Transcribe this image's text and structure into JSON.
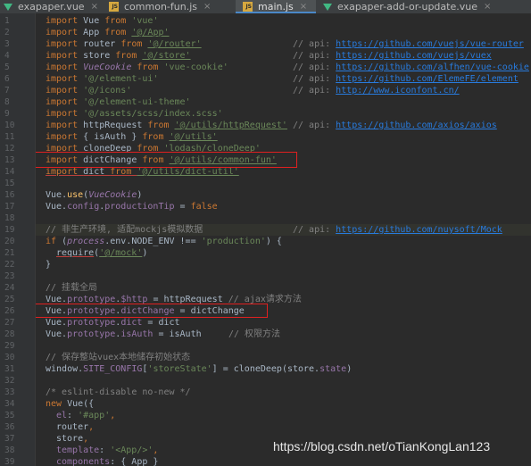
{
  "tabs": [
    {
      "label": "exapaper.vue",
      "type": "vue",
      "active": false
    },
    {
      "label": "common-fun.js",
      "type": "js",
      "active": false
    },
    {
      "label": "main.js",
      "type": "js",
      "active": true
    },
    {
      "label": "exapaper-add-or-update.vue",
      "type": "vue",
      "active": false
    }
  ],
  "close_glyph": "×",
  "line_numbers": [
    "1",
    "2",
    "3",
    "4",
    "5",
    "6",
    "7",
    "8",
    "9",
    "10",
    "11",
    "12",
    "13",
    "14",
    "15",
    "16",
    "17",
    "18",
    "19",
    "20",
    "21",
    "22",
    "23",
    "24",
    "25",
    "26",
    "27",
    "28",
    "29",
    "30",
    "31",
    "32",
    "33",
    "34",
    "35",
    "36",
    "37",
    "38",
    "39"
  ],
  "code": {
    "l1": {
      "a": "import ",
      "b": "Vue ",
      "c": "from ",
      "d": "'vue'"
    },
    "l2": {
      "a": "import ",
      "b": "App ",
      "c": "from ",
      "d": "'@/App'"
    },
    "l3": {
      "a": "import ",
      "b": "router ",
      "c": "from ",
      "d": "'@/router'",
      "e": "// api: ",
      "f": "https://github.com/vuejs/vue-router"
    },
    "l4": {
      "a": "import ",
      "b": "store ",
      "c": "from ",
      "d": "'@/store'",
      "e": "// api: ",
      "f": "https://github.com/vuejs/vuex"
    },
    "l5": {
      "a": "import ",
      "b": "VueCookie ",
      "c": "from ",
      "d": "'vue-cookie'",
      "e": "// api: ",
      "f": "https://github.com/alfhen/vue-cookie"
    },
    "l6": {
      "a": "import ",
      "d": "'@/element-ui'",
      "e": "// api: ",
      "f": "https://github.com/ElemeFE/element"
    },
    "l7": {
      "a": "import ",
      "d": "'@/icons'",
      "e": "// api: ",
      "f": "http://www.iconfont.cn/"
    },
    "l8": {
      "a": "import ",
      "d": "'@/element-ui-theme'"
    },
    "l9": {
      "a": "import ",
      "d": "'@/assets/scss/index.scss'"
    },
    "l10": {
      "a": "import ",
      "b": "httpRequest ",
      "c": "from ",
      "d": "'@/utils/httpRequest'",
      "e": " // api: ",
      "f": "https://github.com/axios/axios"
    },
    "l11": {
      "a": "import ",
      "b": "{ isAuth } ",
      "c": "from ",
      "d": "'@/utils'"
    },
    "l12": {
      "a": "import ",
      "b": "cloneDeep ",
      "c": "from ",
      "d": "'lodash/cloneDeep'"
    },
    "l13": {
      "a": "import ",
      "b": "dictChange ",
      "c": "from ",
      "d": "'@/utils/common-fun'"
    },
    "l14": {
      "a": "import ",
      "b": "dict ",
      "c": "from ",
      "d": "'@/utils/dict-util'"
    },
    "l16": {
      "a": "Vue",
      "b": ".",
      "c": "use",
      "d": "(",
      "e": "VueCookie",
      "f": ")"
    },
    "l17": {
      "a": "Vue.",
      "b": "config",
      "c": ".",
      "d": "productionTip",
      "e": " = ",
      "f": "false"
    },
    "l19": {
      "a": "// 非生产环境, 适配mockjs模拟数据",
      "e": "// api: ",
      "f": "https://github.com/nuysoft/Mock"
    },
    "l20": {
      "a": "if ",
      "b": "(",
      "c": "process",
      "d": ".env.NODE_ENV !== ",
      "e": "'production'",
      "f": ") {"
    },
    "l21": {
      "a": "require",
      "b": "(",
      "c": "'@/mock'",
      "d": ")"
    },
    "l22": {
      "a": "}"
    },
    "l24": {
      "a": "// 挂载全局"
    },
    "l25": {
      "a": "Vue.",
      "b": "prototype",
      "c": ".",
      "d": "$http",
      "e": " = httpRequest ",
      "f": "// ajax请求方法"
    },
    "l26": {
      "a": "Vue.",
      "b": "prototype",
      "c": ".",
      "d": "dictChange",
      "e": " = dictChange"
    },
    "l27": {
      "a": "Vue.",
      "b": "prototype",
      "c": ".",
      "d": "dict",
      "e": " = dict"
    },
    "l28": {
      "a": "Vue.",
      "b": "prototype",
      "c": ".",
      "d": "isAuth",
      "e": " = isAuth",
      "f": "// 权限方法"
    },
    "l30": {
      "a": "// 保存整站vuex本地储存初始状态"
    },
    "l31": {
      "a": "window",
      "b": ".",
      "c": "SITE_CONFIG",
      "d": "[",
      "e": "'storeState'",
      "f": "] = cloneDeep(store.",
      "g": "state",
      "h": ")"
    },
    "l33": {
      "a": "/* eslint-disable no-new */"
    },
    "l34": {
      "a": "new ",
      "b": "Vue({"
    },
    "l35": {
      "a": "el",
      "b": ": ",
      "c": "'#app'",
      "d": ","
    },
    "l36": {
      "a": "router",
      "b": ","
    },
    "l37": {
      "a": "store",
      "b": ","
    },
    "l38": {
      "a": "template",
      "b": ": ",
      "c": "'<App/>'",
      "d": ","
    },
    "l39": {
      "a": "components",
      "b": ": { App }"
    }
  },
  "watermark": "https://blog.csdn.net/oTianKongLan123",
  "colors": {
    "highlight_box": "#e02020",
    "keyword": "#cc7832",
    "string": "#6a8759",
    "link": "#287bde",
    "comment": "#808080"
  }
}
